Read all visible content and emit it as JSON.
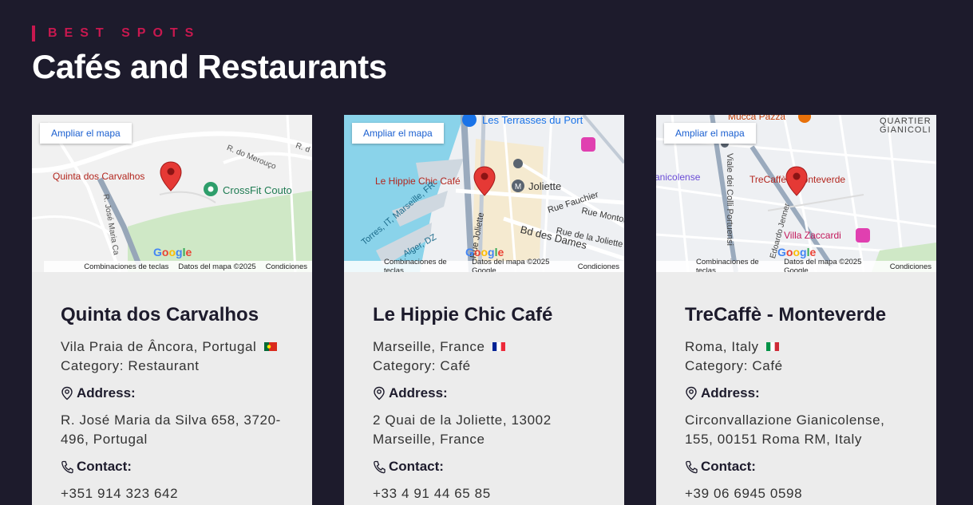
{
  "header": {
    "eyebrow": "BEST SPOTS",
    "title": "Cafés and Restaurants"
  },
  "map_ui": {
    "enlarge_label": "Ampliar el mapa",
    "shortcuts_label": "Combinaciones de teclas",
    "terms_label": "Condiciones",
    "logo": "Google"
  },
  "cards": [
    {
      "name": "Quinta dos Carvalhos",
      "location": "Vila Praia de Âncora, Portugal",
      "flag": "portugal-flag",
      "category": "Category: Restaurant",
      "address_label": "Address:",
      "address": "R. José Maria da Silva 658, 3720-496, Portugal",
      "contact_label": "Contact:",
      "contact": "+351 914 323 642",
      "map": {
        "map_data": "Datos del mapa ©2025",
        "pin_label": "Quinta dos Carvalhos",
        "labels": [
          "CrossFit Couto",
          "R. do Merouço",
          "R. José Maria Ca",
          "R. d"
        ]
      }
    },
    {
      "name": "Le Hippie Chic Café",
      "location": "Marseille, France",
      "flag": "france-flag",
      "category": "Category: Café",
      "address_label": "Address:",
      "address": "2 Quai de la Joliette, 13002 Marseille, France",
      "contact_label": "Contact:",
      "contact": "+33 4 91 44 65 85",
      "map": {
        "map_data": "Datos del mapa ©2025 Google",
        "pin_label": "Le Hippie Chic Café",
        "labels": [
          "Les Terrasses du Port",
          "Joliette",
          "Rue Fauchier",
          "Rue Montol",
          "Bd des Dames",
          "Rue de la Joliette",
          "Rue Joliette",
          "Torres, IT, Marseille, FR",
          "Alger, DZ"
        ]
      }
    },
    {
      "name": "TreCaffè - Monteverde",
      "location": "Roma, Italy",
      "flag": "italy-flag",
      "category": "Category: Café",
      "address_label": "Address:",
      "address": "Circonvallazione Gianicolense, 155, 00151 Roma RM, Italy",
      "contact_label": "Contact:",
      "contact": "+39 06 6945 0598",
      "map": {
        "map_data": "Datos del mapa ©2025 Google",
        "pin_label": "TreCaffè - Monteverde",
        "labels": [
          "Mucca Pazza",
          "QUARTIER",
          "GIANICOLI",
          "anicolense",
          "Viale dei Colli Portuensi",
          "Villa Zaccardi",
          "Edoardo Jenner"
        ]
      }
    }
  ],
  "colors": {
    "background": "#1d1b2c",
    "accent": "#c8184f",
    "card": "#ececec",
    "link": "#1a5fd0",
    "pin": "#e53935"
  }
}
